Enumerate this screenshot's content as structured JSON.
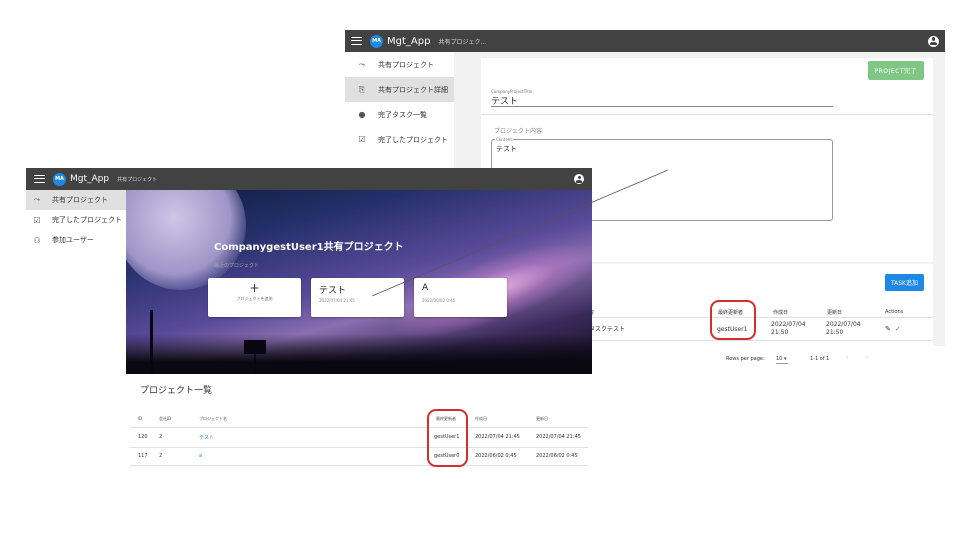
{
  "app": {
    "name": "Mgt_App",
    "avatar": "MA",
    "back_crumb": "共有プロジェク...",
    "front_crumb": "共有プロジェクト"
  },
  "back": {
    "sidebar": [
      {
        "icon": "handshake-icon",
        "glyph": "⤳",
        "label": "共有プロジェクト"
      },
      {
        "icon": "project-detail-icon",
        "glyph": "⎘",
        "label": "共有プロジェクト詳細"
      },
      {
        "icon": "check-circle-icon",
        "glyph": "●",
        "label": "完了タスク一覧"
      },
      {
        "icon": "calendar-check-icon",
        "glyph": "☑",
        "label": "完了したプロジェクト"
      }
    ],
    "project_done_button": "PROJECT完了",
    "title_field_label": "CompanyProjectTitle",
    "title_value": "テスト",
    "content_label": "プロジェクト内容",
    "content_field_label": "Content",
    "content_value": "テスト",
    "task_add_button": "TASK追加",
    "table": {
      "headers": [
        "容",
        "最終更新者",
        "作成日",
        "更新日",
        "Actions"
      ],
      "row": [
        "タスクテスト",
        "gestUser1",
        "2022/07/04 21:50",
        "2022/07/04 21:50"
      ]
    },
    "pagination": {
      "rows_label": "Rows per page:",
      "rows_value": "10",
      "range": "1-1 of 1"
    }
  },
  "front": {
    "sidebar": [
      {
        "icon": "handshake-icon",
        "glyph": "⤳",
        "label": "共有プロジェクト"
      },
      {
        "icon": "calendar-check-icon",
        "glyph": "☑",
        "label": "完了したプロジェクト"
      },
      {
        "icon": "group-icon",
        "glyph": "⚇",
        "label": "参加ユーザー"
      }
    ],
    "hero_title": "CompanygestUser1共有プロジェクト",
    "hero_sub": "最近のプロジェクト",
    "add_card_label": "プロジェクトを追加",
    "add_card_plus": "+",
    "cards": [
      {
        "title": "テスト",
        "date": "2022/07/04 21:45"
      },
      {
        "title": "A",
        "date": "2022/06/02 0:45"
      }
    ],
    "list_title": "プロジェクト一覧",
    "table": {
      "headers": [
        "ID",
        "会社ID",
        "プロジェクト名",
        "最終更新者",
        "作成日",
        "更新日"
      ],
      "rows": [
        [
          "120",
          "2",
          "テスト",
          "gestUser1",
          "2022/07/04 21:45",
          "2022/07/04 21:45"
        ],
        [
          "117",
          "2",
          "a",
          "gestUser0",
          "2022/06/02 0:45",
          "2022/06/02 0:45"
        ]
      ]
    }
  },
  "colors": {
    "appbar": "#424242",
    "accent": "#1e88e5",
    "success": "#81c784",
    "highlight": "#d32f2f"
  }
}
